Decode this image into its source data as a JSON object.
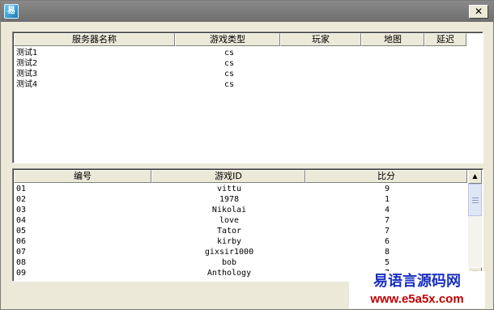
{
  "window": {
    "icon_glyph": "易",
    "close_glyph": "✕"
  },
  "server_list": {
    "columns": [
      "服务器名称",
      "游戏类型",
      "玩家",
      "地图",
      "延迟"
    ],
    "rows": [
      {
        "name": "测试1",
        "type": "cs"
      },
      {
        "name": "测试2",
        "type": "cs"
      },
      {
        "name": "测试3",
        "type": "cs"
      },
      {
        "name": "测试4",
        "type": "cs"
      }
    ]
  },
  "score_list": {
    "columns": [
      "编号",
      "游戏ID",
      "比分"
    ],
    "rows": [
      {
        "no": "01",
        "id": "vittu",
        "score": "9"
      },
      {
        "no": "02",
        "id": "1978",
        "score": "1"
      },
      {
        "no": "03",
        "id": "Nikolai",
        "score": "4"
      },
      {
        "no": "04",
        "id": "love",
        "score": "7"
      },
      {
        "no": "05",
        "id": "Tator",
        "score": "7"
      },
      {
        "no": "06",
        "id": "kirby",
        "score": "6"
      },
      {
        "no": "07",
        "id": "gixsir1000",
        "score": "8"
      },
      {
        "no": "08",
        "id": "bob",
        "score": "5"
      },
      {
        "no": "09",
        "id": "Anthology",
        "score": "7"
      }
    ],
    "scroll_up_glyph": "▲",
    "scroll_down_glyph": "▼"
  },
  "watermark": {
    "title": "易语言源码网",
    "url": "www.e5a5x.com"
  }
}
